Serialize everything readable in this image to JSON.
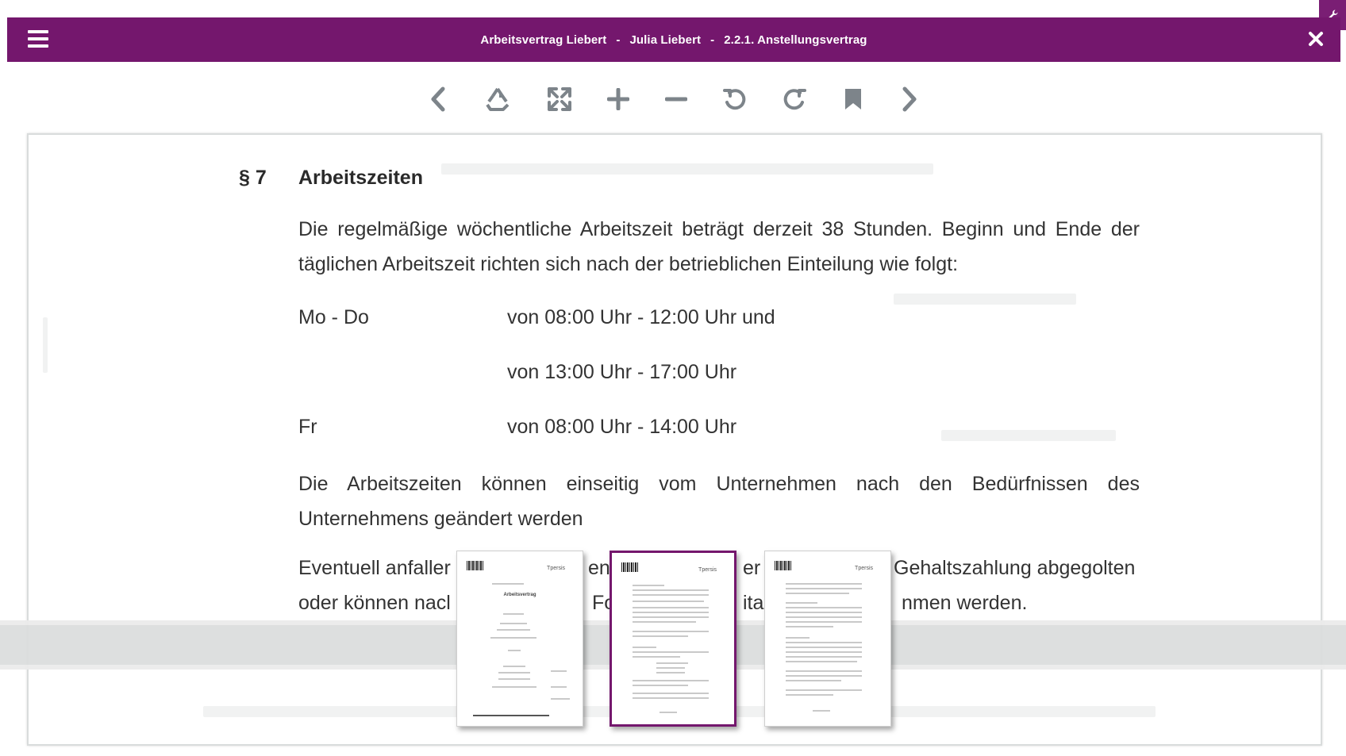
{
  "header": {
    "document": "Arbeitsvertrag Liebert",
    "separator": "-",
    "person": "Julia Liebert",
    "section": "2.2.1. Anstellungsvertrag",
    "bg_color": "#74176d"
  },
  "toolbar": {
    "icons": [
      "chevron-left-icon",
      "recycle-icon",
      "expand-icon",
      "plus-icon",
      "minus-icon",
      "rotate-left-icon",
      "rotate-right-icon",
      "bookmark-icon",
      "chevron-right-icon"
    ],
    "icon_color": "#7d848a"
  },
  "document": {
    "paragraph_number": "§ 7",
    "paragraph_title": "Arbeitszeiten",
    "intro": "Die regelmäßige wöchentliche Arbeitszeit beträgt derzeit 38 Stunden. Beginn und Ende der täglichen Arbeitszeit richten sich nach der betrieblichen Einteilung wie folgt:",
    "schedule": [
      {
        "day": "Mo - Do",
        "time": "von 08:00 Uhr - 12:00 Uhr und"
      },
      {
        "day": "",
        "time": "von 13:00 Uhr - 17:00 Uhr"
      },
      {
        "day": "Fr",
        "time": "von 08:00 Uhr - 14:00 Uhr"
      }
    ],
    "change_text": "Die Arbeitszeiten können einseitig vom Unternehmen nach den Bedürfnissen des Unternehmens geändert werden",
    "overtime_fragments": {
      "line1_a": "Eventuell anfaller",
      "line1_b": "en",
      "line1_c": "er",
      "line1_d": "Gehaltszahlung abgegolten",
      "line2_a": "oder können nacl",
      "line2_b": "Fo",
      "line2_c": "ita",
      "line2_d": "nmen werden."
    }
  },
  "thumbnails": [
    {
      "page": 1,
      "active": false,
      "title": "Arbeitsvertrag"
    },
    {
      "page": 2,
      "active": true,
      "title": ""
    },
    {
      "page": 3,
      "active": false,
      "title": ""
    }
  ],
  "colors": {
    "accent": "#74176d",
    "icon": "#7d848a",
    "strip": "#dcdede"
  }
}
